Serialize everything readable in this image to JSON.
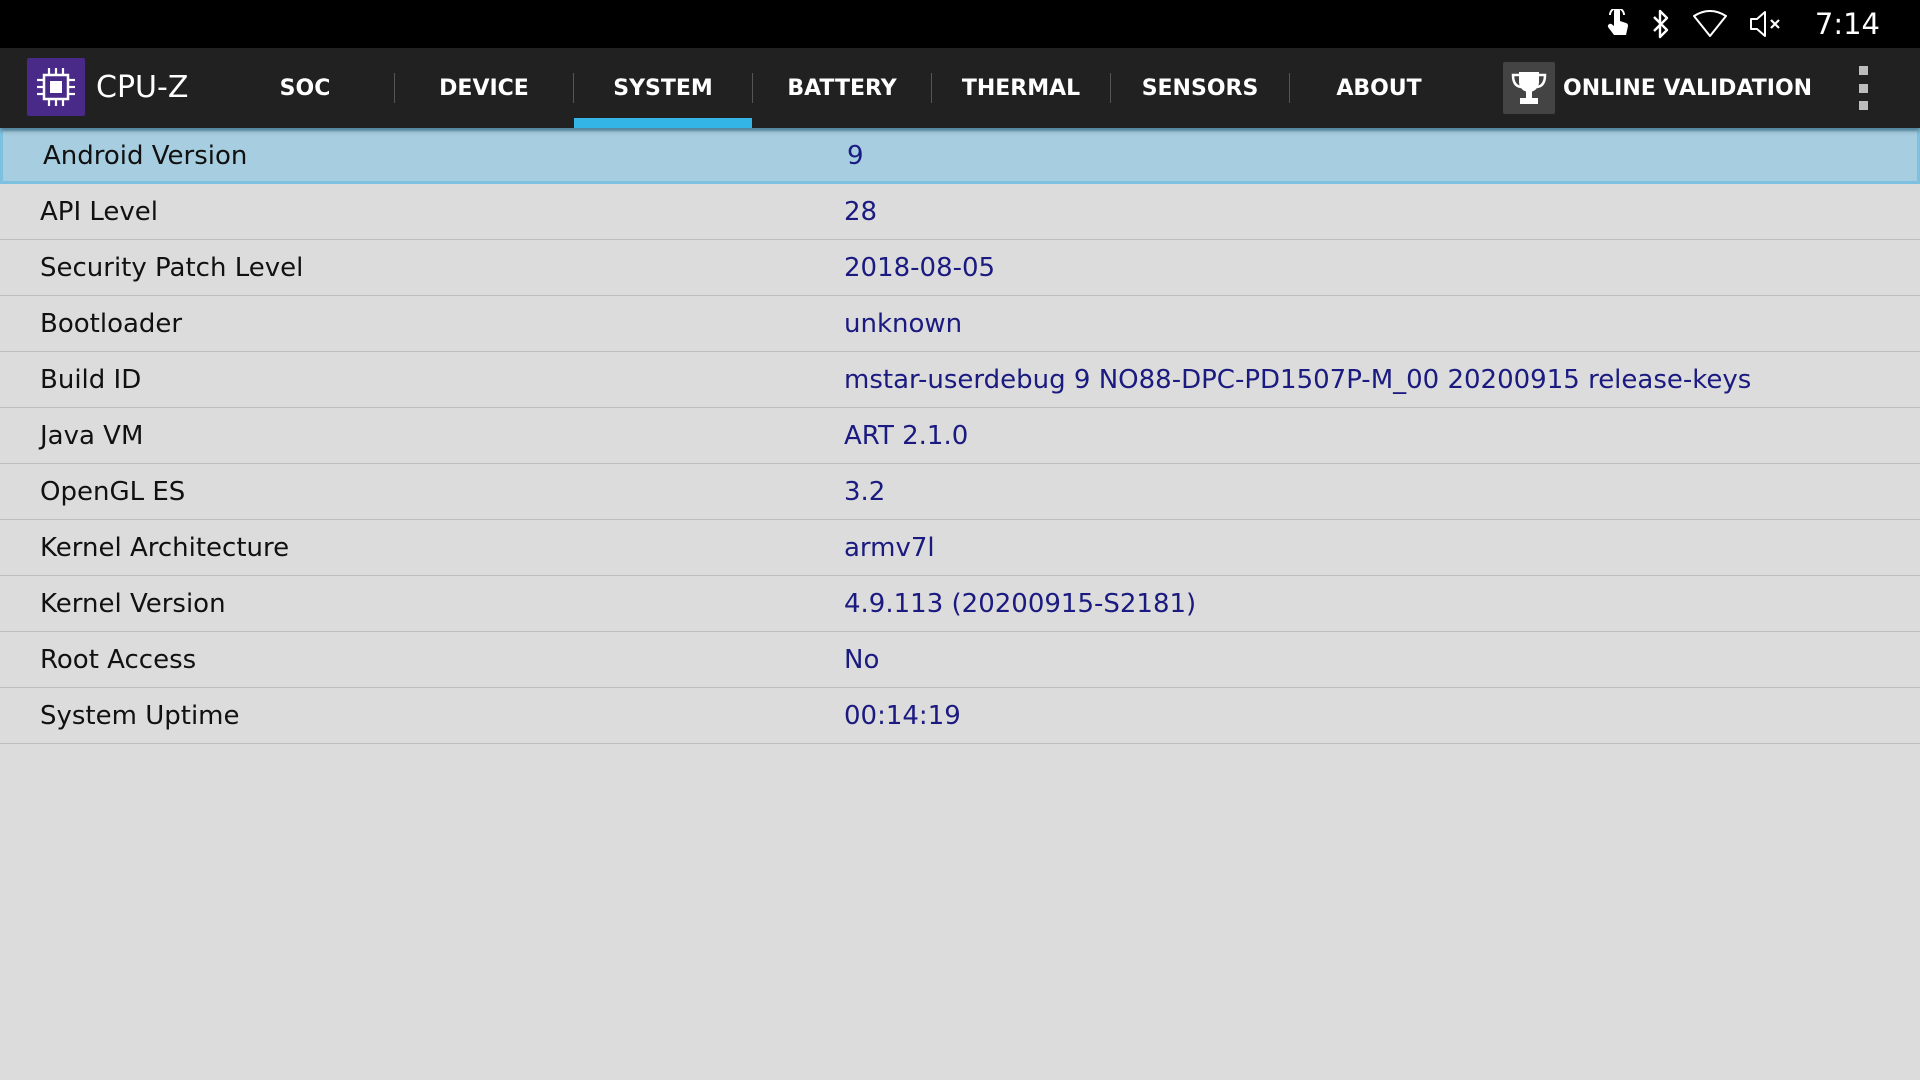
{
  "statusbar": {
    "time": "7:14",
    "icons": [
      "touch-icon",
      "bluetooth-icon",
      "wifi-icon",
      "volume-muted-icon"
    ]
  },
  "appbar": {
    "title": "CPU-Z",
    "logo_icon": "cpu-chip-icon",
    "tabs": [
      {
        "label": "SOC"
      },
      {
        "label": "DEVICE"
      },
      {
        "label": "SYSTEM"
      },
      {
        "label": "BATTERY"
      },
      {
        "label": "THERMAL"
      },
      {
        "label": "SENSORS"
      },
      {
        "label": "ABOUT"
      }
    ],
    "active_tab": "SYSTEM",
    "validation_label": "ONLINE VALIDATION",
    "validation_icon": "trophy-icon",
    "accent_color": "#33b5e5"
  },
  "system_info": {
    "rows": [
      {
        "label": "Android Version",
        "value": "9"
      },
      {
        "label": "API Level",
        "value": "28"
      },
      {
        "label": "Security Patch Level",
        "value": "2018-08-05"
      },
      {
        "label": "Bootloader",
        "value": "unknown"
      },
      {
        "label": "Build ID",
        "value": "mstar-userdebug 9 NO88-DPC-PD1507P-M_00 20200915 release-keys"
      },
      {
        "label": "Java VM",
        "value": "ART 2.1.0"
      },
      {
        "label": "OpenGL ES",
        "value": "3.2"
      },
      {
        "label": "Kernel Architecture",
        "value": "armv7l"
      },
      {
        "label": "Kernel Version",
        "value": "4.9.113 (20200915-S2181)"
      },
      {
        "label": "Root Access",
        "value": "No"
      },
      {
        "label": "System Uptime",
        "value": "00:14:19"
      }
    ],
    "selected_row": "Android Version",
    "label_color": "#111111",
    "value_color": "#1a1a80",
    "selection_color": "#a6cee0"
  }
}
